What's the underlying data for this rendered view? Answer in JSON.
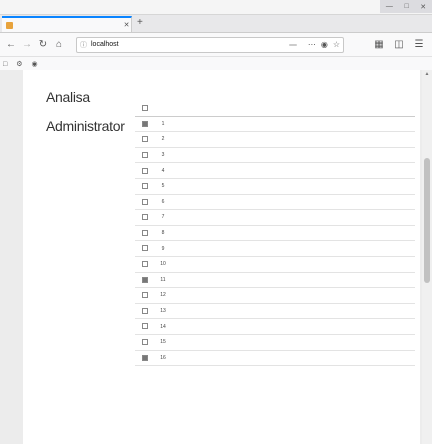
{
  "browser": {
    "menu": [
      "",
      "",
      "",
      "",
      "",
      ""
    ],
    "tab_title": "",
    "url_host": "localhost",
    "url_path": "",
    "zoom": "",
    "bookmarks": [
      "",
      "",
      ""
    ]
  },
  "sidebar": {
    "top_sub": "",
    "sections": [
      {
        "title": "Analisa",
        "sub": ""
      },
      {
        "title": "Administrator",
        "sub": ""
      }
    ]
  },
  "main": {
    "intro": "",
    "header": {
      "no": "",
      "symptom": ""
    },
    "rows": [
      {
        "no": "1",
        "symptom": "",
        "checked": true
      },
      {
        "no": "2",
        "symptom": "",
        "checked": false
      },
      {
        "no": "3",
        "symptom": "",
        "checked": false
      },
      {
        "no": "4",
        "symptom": "",
        "checked": false
      },
      {
        "no": "5",
        "symptom": "",
        "checked": false
      },
      {
        "no": "6",
        "symptom": "",
        "checked": false
      },
      {
        "no": "7",
        "symptom": "",
        "checked": false
      },
      {
        "no": "8",
        "symptom": "",
        "checked": false
      },
      {
        "no": "9",
        "symptom": "",
        "checked": false
      },
      {
        "no": "10",
        "symptom": "",
        "checked": false
      },
      {
        "no": "11",
        "symptom": "",
        "checked": true
      },
      {
        "no": "12",
        "symptom": "",
        "checked": false
      },
      {
        "no": "13",
        "symptom": "",
        "checked": false
      },
      {
        "no": "14",
        "symptom": "",
        "checked": false
      },
      {
        "no": "15",
        "symptom": "",
        "checked": false
      },
      {
        "no": "16",
        "symptom": "",
        "checked": true
      }
    ]
  }
}
